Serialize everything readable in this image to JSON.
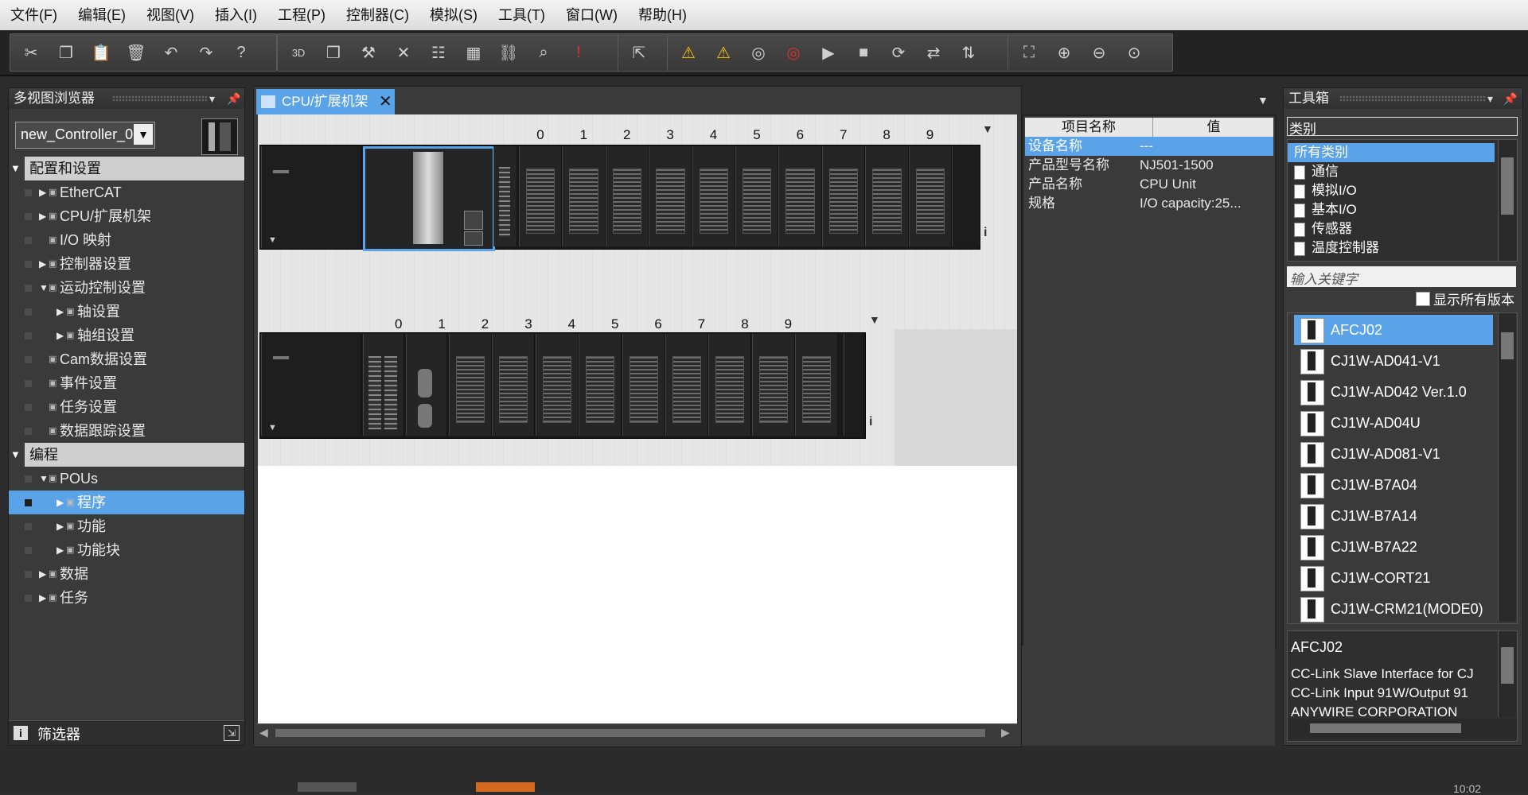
{
  "menu": [
    "文件(F)",
    "编辑(E)",
    "视图(V)",
    "插入(I)",
    "工程(P)",
    "控制器(C)",
    "模拟(S)",
    "工具(T)",
    "窗口(W)",
    "帮助(H)"
  ],
  "toolbar": {
    "group1": [
      "scissors-icon",
      "copy-icon",
      "paste-icon",
      "delete-icon",
      "undo-icon",
      "redo-icon",
      "help-icon"
    ],
    "group2": [
      "3d-icon",
      "window-icon",
      "hammer-icon",
      "cross-ref-icon",
      "ladder-icon",
      "build-icon",
      "network-icon",
      "binoculars-icon",
      "error-icon"
    ],
    "group3": [
      "online-icon"
    ],
    "group4": [
      "warning-icon",
      "warning-off-icon",
      "monitor-icon",
      "monitor-off-icon",
      "run-icon",
      "stop-icon",
      "reset-icon",
      "sync-icon",
      "transfer-icon"
    ],
    "group5": [
      "fit-icon",
      "zoom-in-icon",
      "zoom-out-icon",
      "zoom-reset-icon"
    ],
    "group4_labels": {
      "warning": "⚠",
      "warning_off": "⚠"
    }
  },
  "left_panel": {
    "title": "多视图浏览器",
    "controller": "new_Controller_0",
    "section_config": "配置和设置",
    "items_config": [
      {
        "label": "EtherCAT",
        "indent": 1,
        "arrow": "▶"
      },
      {
        "label": "CPU/扩展机架",
        "indent": 1,
        "arrow": "▶"
      },
      {
        "label": "I/O 映射",
        "indent": 1,
        "arrow": ""
      },
      {
        "label": "控制器设置",
        "indent": 1,
        "arrow": "▶"
      },
      {
        "label": "运动控制设置",
        "indent": 1,
        "arrow": "▼"
      },
      {
        "label": "轴设置",
        "indent": 2,
        "arrow": "▶"
      },
      {
        "label": "轴组设置",
        "indent": 2,
        "arrow": "▶"
      },
      {
        "label": "Cam数据设置",
        "indent": 1,
        "arrow": ""
      },
      {
        "label": "事件设置",
        "indent": 1,
        "arrow": ""
      },
      {
        "label": "任务设置",
        "indent": 1,
        "arrow": ""
      },
      {
        "label": "数据跟踪设置",
        "indent": 1,
        "arrow": ""
      }
    ],
    "section_prog": "编程",
    "items_prog": [
      {
        "label": "POUs",
        "indent": 1,
        "arrow": "▼"
      },
      {
        "label": "程序",
        "indent": 2,
        "arrow": "▶",
        "selected": true
      },
      {
        "label": "功能",
        "indent": 2,
        "arrow": "▶"
      },
      {
        "label": "功能块",
        "indent": 2,
        "arrow": "▶"
      },
      {
        "label": "数据",
        "indent": 1,
        "arrow": "▶"
      },
      {
        "label": "任务",
        "indent": 1,
        "arrow": "▶"
      }
    ],
    "filter": "筛选器"
  },
  "center": {
    "tab_label": "CPU/扩展机架",
    "rack1_slots": [
      "0",
      "1",
      "2",
      "3",
      "4",
      "5",
      "6",
      "7",
      "8",
      "9"
    ],
    "rack2_slots": [
      "0",
      "1",
      "2",
      "3",
      "4",
      "5",
      "6",
      "7",
      "8",
      "9"
    ],
    "info_mark": "i"
  },
  "properties": {
    "col_name": "项目名称",
    "col_value": "值",
    "rows": [
      {
        "name": "设备名称",
        "value": "---",
        "selected": true
      },
      {
        "name": "产品型号名称",
        "value": "NJ501-1500"
      },
      {
        "name": "产品名称",
        "value": "CPU Unit"
      },
      {
        "name": "规格",
        "value": "I/O capacity:25..."
      }
    ]
  },
  "toolbox": {
    "title": "工具箱",
    "category_label": "类别",
    "categories": [
      "所有类别",
      "通信",
      "模拟I/O",
      "基本I/O",
      "传感器",
      "温度控制器"
    ],
    "search_placeholder": "输入关键字",
    "show_all_versions": "显示所有版本",
    "items": [
      "AFCJ02",
      "CJ1W-AD041-V1",
      "CJ1W-AD042 Ver.1.0",
      "CJ1W-AD04U",
      "CJ1W-AD081-V1",
      "CJ1W-B7A04",
      "CJ1W-B7A14",
      "CJ1W-B7A22",
      "CJ1W-CORT21",
      "CJ1W-CRM21(MODE0)"
    ],
    "desc_title": "AFCJ02",
    "desc_lines": [
      "CC-Link Slave Interface for CJ",
      "CC-Link Input 91W/Output 91",
      "ANYWIRE CORPORATION"
    ]
  },
  "status": {
    "clock": "10:02"
  },
  "colors": {
    "accent": "#5aa3e8",
    "panel": "#3a3a3a",
    "dark": "#232323"
  }
}
